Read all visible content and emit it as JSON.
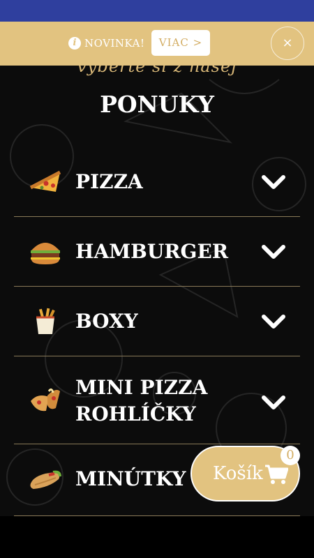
{
  "banner": {
    "info_icon": "i",
    "text": "NOVINKA!",
    "more_label": "VIAC >",
    "close_label": "×"
  },
  "heading": {
    "subtitle": "vyberte si z našej",
    "title": "PONUKY"
  },
  "menu": {
    "items": [
      {
        "label": "PIZZA",
        "icon": "pizza-icon"
      },
      {
        "label": "HAMBURGER",
        "icon": "hamburger-icon"
      },
      {
        "label": "BOXY",
        "icon": "fries-box-icon"
      },
      {
        "label": "MINI PIZZA",
        "label2": "ROHLÍČKY",
        "icon": "mini-pizza-icon"
      },
      {
        "label": "MINÚTKY",
        "icon": "wrap-icon"
      }
    ]
  },
  "cart": {
    "label": "Košík",
    "count": "0"
  },
  "colors": {
    "accent": "#e2c380",
    "status_bar": "#2f3f9e",
    "background": "#0c0c0c",
    "divider": "#8a7a58"
  }
}
